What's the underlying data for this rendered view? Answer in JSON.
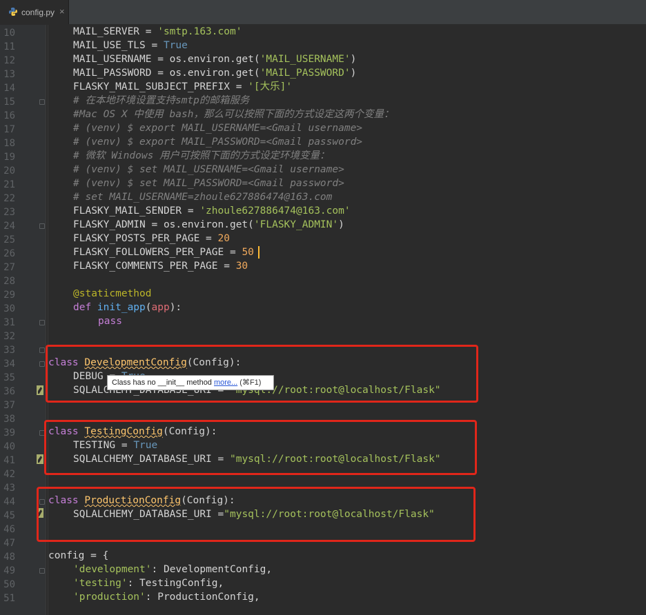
{
  "tab": {
    "title": "config.py",
    "close": "×",
    "icon": "python-file-icon"
  },
  "tooltip": {
    "text": "Class has no __init__ method ",
    "link": "more...",
    "shortcut": " (⌘F1)"
  },
  "lines": [
    {
      "n": "10",
      "code": "MAIL_SERVER = 'smtp.163.com'"
    },
    {
      "n": "11",
      "code": "MAIL_USE_TLS = True"
    },
    {
      "n": "12",
      "code": "MAIL_USERNAME = os.environ.get('MAIL_USERNAME')"
    },
    {
      "n": "13",
      "code": "MAIL_PASSWORD = os.environ.get('MAIL_PASSWORD')"
    },
    {
      "n": "14",
      "code": "FLASKY_MAIL_SUBJECT_PREFIX = '[大乐]'"
    },
    {
      "n": "15",
      "code": "# 在本地环境设置支持smtp的邮箱服务"
    },
    {
      "n": "16",
      "code": "#Mac OS X 中使用 bash，那么可以按照下面的方式设定这两个变量："
    },
    {
      "n": "17",
      "code": "# (venv) $ export MAIL_USERNAME=<Gmail username>"
    },
    {
      "n": "18",
      "code": "# (venv) $ export MAIL_PASSWORD=<Gmail password>"
    },
    {
      "n": "19",
      "code": "# 微软 Windows 用户可按照下面的方式设定环境变量："
    },
    {
      "n": "20",
      "code": "# (venv) $ set MAIL_USERNAME=<Gmail username>"
    },
    {
      "n": "21",
      "code": "# (venv) $ set MAIL_PASSWORD=<Gmail password>"
    },
    {
      "n": "22",
      "code": "# set MAIL_USERNAME=zhoule627886474@163.com"
    },
    {
      "n": "23",
      "code": "FLASKY_MAIL_SENDER = 'zhoule627886474@163.com'"
    },
    {
      "n": "24",
      "code": "FLASKY_ADMIN = os.environ.get('FLASKY_ADMIN')"
    },
    {
      "n": "25",
      "code": "FLASKY_POSTS_PER_PAGE = 20"
    },
    {
      "n": "26",
      "code": "FLASKY_FOLLOWERS_PER_PAGE = 50"
    },
    {
      "n": "27",
      "code": "FLASKY_COMMENTS_PER_PAGE = 30"
    },
    {
      "n": "28",
      "code": ""
    },
    {
      "n": "29",
      "code": "@staticmethod"
    },
    {
      "n": "30",
      "code": "def init_app(app):"
    },
    {
      "n": "31",
      "code": "pass"
    },
    {
      "n": "32",
      "code": ""
    },
    {
      "n": "33",
      "code": ""
    },
    {
      "n": "34",
      "code": "class DevelopmentConfig(Config):"
    },
    {
      "n": "35",
      "code": "DEBUG = True"
    },
    {
      "n": "36",
      "code": "SQLALCHEMY_DATABASE_URI = \"mysql://root:root@localhost/Flask\""
    },
    {
      "n": "37",
      "code": ""
    },
    {
      "n": "38",
      "code": ""
    },
    {
      "n": "39",
      "code": "class TestingConfig(Config):"
    },
    {
      "n": "40",
      "code": "TESTING = True"
    },
    {
      "n": "41",
      "code": "SQLALCHEMY_DATABASE_URI = \"mysql://root:root@localhost/Flask\""
    },
    {
      "n": "42",
      "code": ""
    },
    {
      "n": "43",
      "code": ""
    },
    {
      "n": "44",
      "code": "class ProductionConfig(Config):"
    },
    {
      "n": "45",
      "code": "SQLALCHEMY_DATABASE_URI =\"mysql://root:root@localhost/Flask\""
    },
    {
      "n": "46",
      "code": ""
    },
    {
      "n": "47",
      "code": ""
    },
    {
      "n": "48",
      "code": "config = {"
    },
    {
      "n": "49",
      "code": "'development': DevelopmentConfig,"
    },
    {
      "n": "50",
      "code": "'testing': TestingConfig,"
    },
    {
      "n": "51",
      "code": "'production': ProductionConfig,"
    }
  ],
  "colors": {
    "highlight_box": "#e0261a",
    "background": "#2b2b2b"
  }
}
